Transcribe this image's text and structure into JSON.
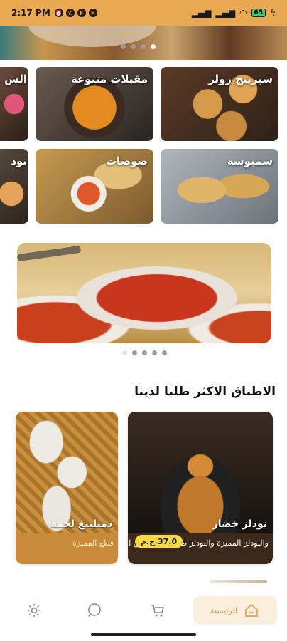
{
  "status_bar": {
    "time": "2:17 PM",
    "battery": "65"
  },
  "categories": [
    {
      "label": "سبرينج رولز",
      "id": "spring-rolls"
    },
    {
      "label": "مقبلات متنوعة",
      "id": "mixed-appetizers"
    },
    {
      "label": "الش",
      "id": "partial-1"
    },
    {
      "label": "سمبوسه",
      "id": "samosa"
    },
    {
      "label": "صوصات",
      "id": "sauces"
    },
    {
      "label": "نود",
      "id": "partial-2"
    }
  ],
  "section": {
    "title": "الاطباق الاكثر طلبا لدينا"
  },
  "dishes": [
    {
      "name": "نودلز خضار",
      "desc": "والنودلز المميزة والنودلز طبق متكامل من الخضار والتوابل",
      "price": "37.0 ج.م"
    },
    {
      "name": "دمبلينغ لحمة",
      "desc": "قطع المميزة"
    }
  ],
  "nav": {
    "home_label": "الرئيسية"
  },
  "colors": {
    "accent": "#e9a852",
    "price_badge": "#f7d84a"
  }
}
